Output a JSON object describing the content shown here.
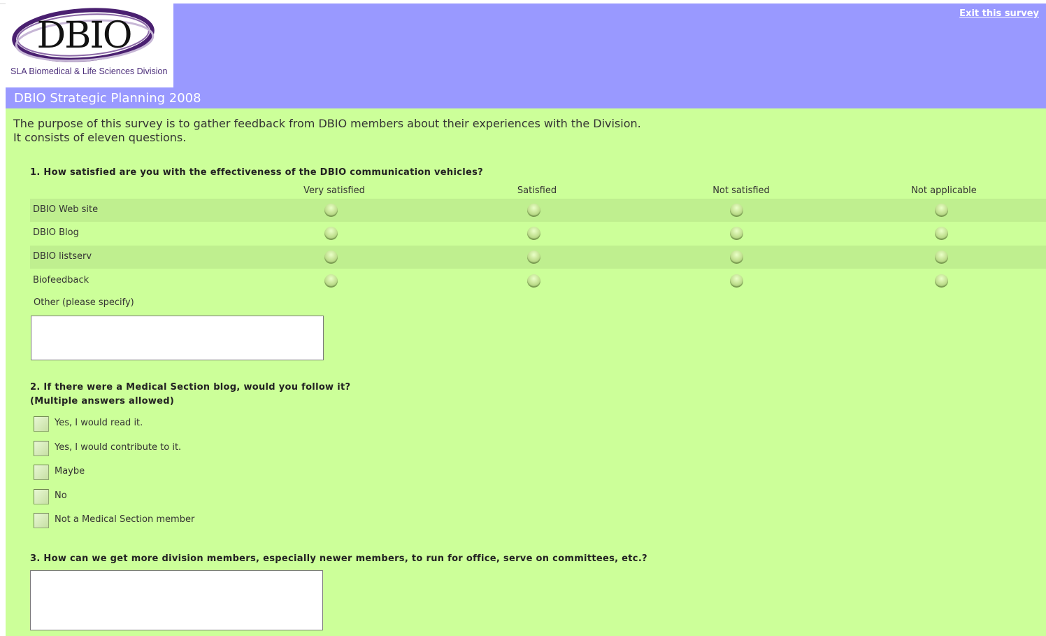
{
  "header": {
    "logo_text": "DBIO",
    "logo_tagline": "SLA Biomedical & Life Sciences Division",
    "exit_link": "Exit this survey",
    "survey_title": "DBIO Strategic Planning 2008"
  },
  "intro": {
    "line1": "The purpose of this survey is to gather feedback from DBIO members about their experiences with the Division.",
    "line2": "It consists of eleven questions."
  },
  "q1": {
    "text": "1. How satisfied are you with the effectiveness of the DBIO communication vehicles?",
    "columns": [
      "Very satisfied",
      "Satisfied",
      "Not satisfied",
      "Not applicable"
    ],
    "rows": [
      "DBIO Web site",
      "DBIO Blog",
      "DBIO listserv",
      "Biofeedback"
    ],
    "other_label": "Other (please specify)",
    "other_value": ""
  },
  "q2": {
    "text_line1": "2. If there were a Medical Section blog, would you follow it?",
    "text_line2": "(Multiple answers allowed)",
    "options": [
      "Yes, I would read it.",
      "Yes, I would contribute to it.",
      "Maybe",
      "No",
      "Not a Medical Section member"
    ]
  },
  "q3": {
    "text": "3. How can we get more division members, especially newer members, to run for office, serve on committees, etc.?",
    "value": ""
  },
  "colors": {
    "header_bg": "#9999ff",
    "content_bg": "#ccff99",
    "row_alt_bg": "#bfef8f",
    "logo_purple": "#5b2a86"
  }
}
